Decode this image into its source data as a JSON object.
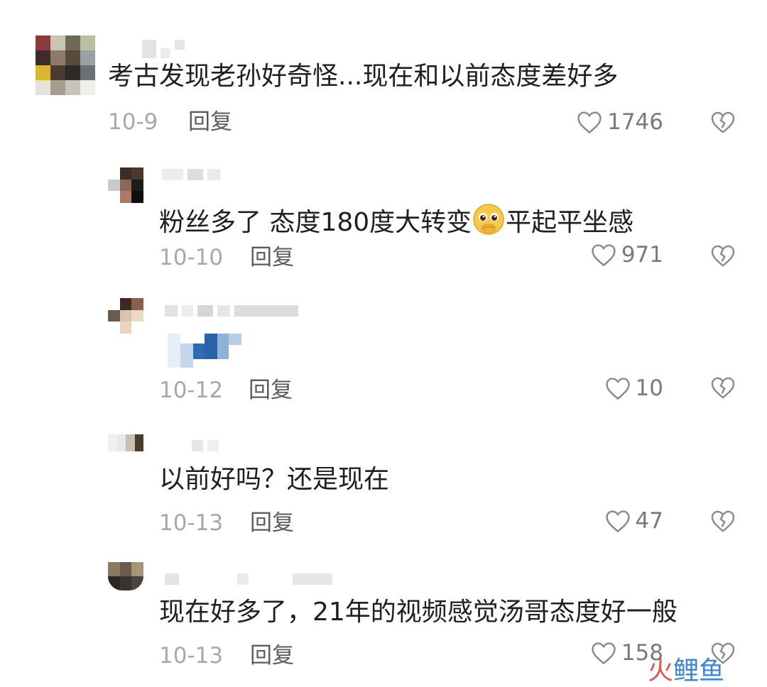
{
  "comments": [
    {
      "text": "考古发现老孙好奇怪...现在和以前态度差好多",
      "date": "10-9",
      "reply": "回复",
      "likes": "1746"
    },
    {
      "text_a": "粉丝多了 态度180度大转变",
      "text_b": "平起平坐感",
      "date": "10-10",
      "reply": "回复",
      "likes": "971"
    },
    {
      "text": "",
      "date": "10-12",
      "reply": "回复",
      "likes": "10"
    },
    {
      "text": "以前好吗？还是现在",
      "date": "10-13",
      "reply": "回复",
      "likes": "47"
    },
    {
      "text": "现在好多了，21年的视频感觉汤哥态度好一般",
      "date": "10-13",
      "reply": "回复",
      "likes": "158"
    }
  ],
  "watermark": {
    "a": "火",
    "b": "鲤鱼"
  },
  "icons": {
    "like": "heart-outline-icon",
    "dislike": "broken-heart-icon",
    "emoji": "pleading-face-emoji"
  },
  "colors": {
    "text": "#1f1f1f",
    "meta": "#a8a8a8",
    "reply": "#5c5c5c"
  }
}
